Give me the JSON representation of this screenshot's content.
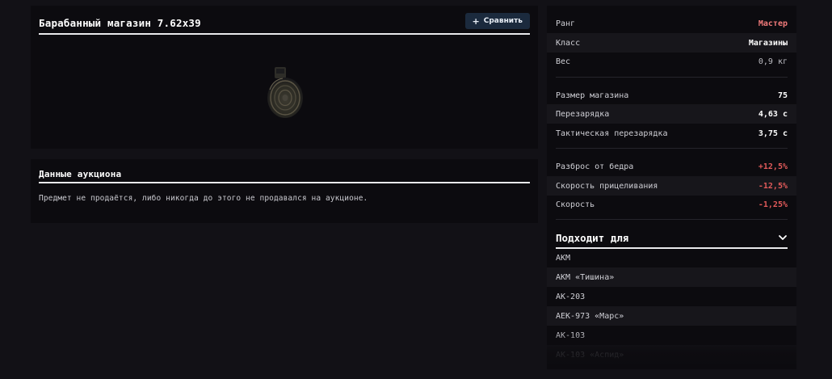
{
  "item": {
    "title": "Барабанный магазин 7.62x39",
    "compare_label": "Сравнить",
    "image_icon": "drum-magazine-image"
  },
  "auction": {
    "title": "Данные аукциона",
    "text": "Предмет не продаётся, либо никогда до этого не продавался на аукционе."
  },
  "stats": {
    "rank": {
      "label": "Ранг",
      "value": "Мастер"
    },
    "class": {
      "label": "Класс",
      "value": "Магазины"
    },
    "weight": {
      "label": "Вес",
      "value": "0,9 кг"
    },
    "mag_size": {
      "label": "Размер магазина",
      "value": "75"
    },
    "reload": {
      "label": "Перезарядка",
      "value": "4,63 с"
    },
    "tactical_reload": {
      "label": "Тактическая перезарядка",
      "value": "3,75 с"
    },
    "hip_spread": {
      "label": "Разброс от бедра",
      "value": "+12,5%"
    },
    "aim_speed": {
      "label": "Скорость прицеливания",
      "value": "-12,5%"
    },
    "speed": {
      "label": "Скорость",
      "value": "-1,25%"
    }
  },
  "fits": {
    "title": "Подходит для",
    "items": [
      "АКМ",
      "АКМ «Тишина»",
      "АК-203",
      "АЕК-973 «Марс»",
      "АК-103",
      "АК-103 «Аспид»"
    ]
  },
  "colors": {
    "accent_rank": "#f07a7a",
    "negative": "#e25a5a",
    "button_bg": "#1b2a3d"
  }
}
